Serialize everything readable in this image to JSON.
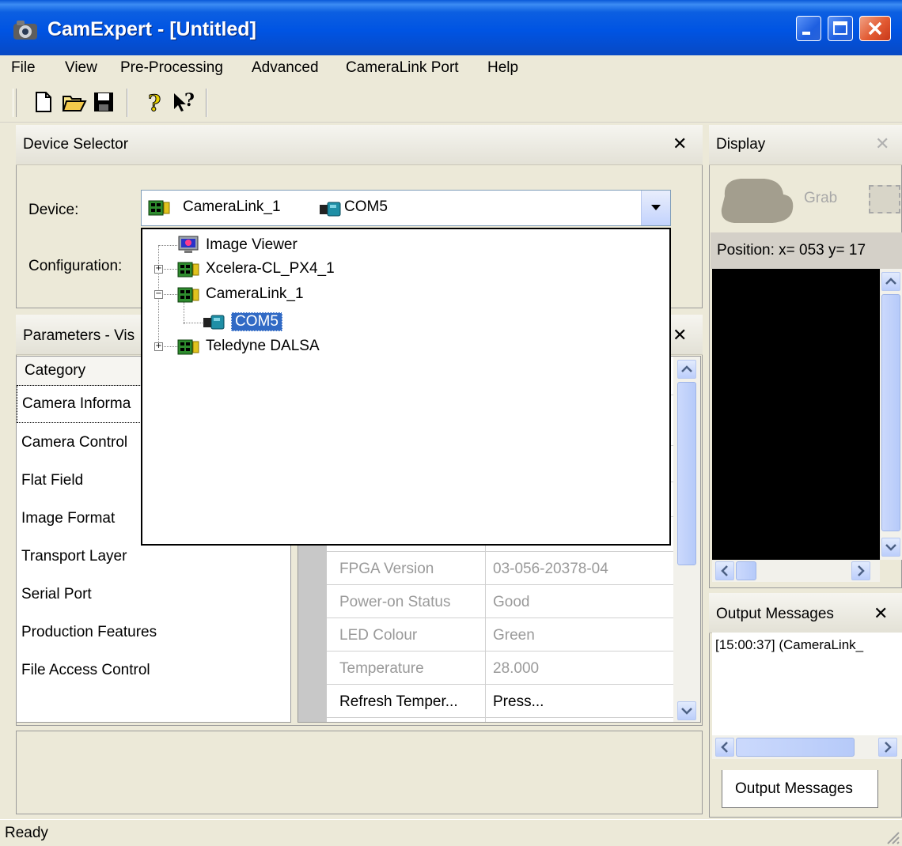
{
  "window": {
    "title": "CamExpert - [Untitled]"
  },
  "menu": [
    "File",
    "View",
    "Pre-Processing",
    "Advanced",
    "CameraLink Port",
    "Help"
  ],
  "toolbar": {
    "icons": [
      "new-file-icon",
      "open-folder-icon",
      "save-disk-icon",
      "help-icon",
      "context-help-icon"
    ]
  },
  "device_selector": {
    "title": "Device Selector",
    "device_label": "Device:",
    "configuration_label": "Configuration:",
    "selected_device": "CameraLink_1",
    "selected_port": "COM5",
    "tree": [
      {
        "label": "Image Viewer"
      },
      {
        "label": "Xcelera-CL_PX4_1"
      },
      {
        "label": "CameraLink_1"
      },
      {
        "label": "COM5"
      },
      {
        "label": "Teledyne DALSA"
      }
    ]
  },
  "parameters": {
    "title": "Parameters - Vis",
    "category_header": "Category",
    "categories": [
      "Camera Informa",
      "Camera Control",
      "Flat Field",
      "Image Format",
      "Transport Layer",
      "Serial Port",
      "Production Features",
      "File Access Control"
    ],
    "rows": [
      {
        "name": "FPGA Version",
        "value": "03-056-20378-04"
      },
      {
        "name": "Power-on Status",
        "value": "Good"
      },
      {
        "name": "LED Colour",
        "value": "Green"
      },
      {
        "name": "Temperature",
        "value": "28.000"
      },
      {
        "name": "Refresh Temper...",
        "value": "Press..."
      }
    ]
  },
  "display": {
    "title": "Display",
    "grab_label": "Grab",
    "position_text": "Position:  x= 053 y= 17"
  },
  "output": {
    "title": "Output Messages",
    "message": "[15:00:37] (CameraLink_",
    "tab_label": "Output Messages"
  },
  "status_text": "Ready",
  "colors": {
    "title_blue": "#0054e3",
    "panel_bg": "#ece9d8",
    "selection_blue": "#316ac5",
    "close_red": "#e25a32"
  }
}
